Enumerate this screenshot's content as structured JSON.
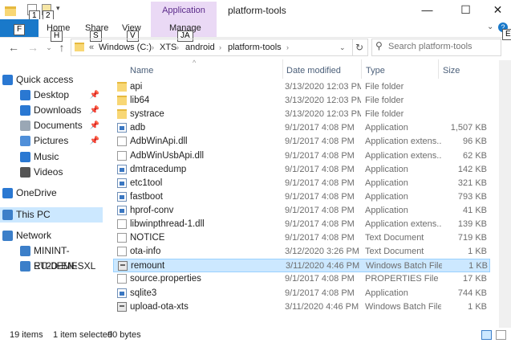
{
  "window": {
    "title": "platform-tools",
    "context_tab": "Application Tools",
    "minimize": "—",
    "maximize": "☐",
    "close": "✕"
  },
  "keytips": {
    "qa1": "1",
    "qa2": "2",
    "file": "F",
    "home": "H",
    "share": "S",
    "view": "V",
    "manage": "JA",
    "expand": "E"
  },
  "ribbon": {
    "file": "F",
    "tabs": [
      "Home",
      "Share",
      "View",
      "Manage"
    ]
  },
  "address": {
    "chevron": "«",
    "segments": [
      "Windows (C:)",
      "XTS",
      "android",
      "platform-tools"
    ],
    "search_placeholder": "Search platform-tools"
  },
  "columns": {
    "name": "Name",
    "date": "Date modified",
    "type": "Type",
    "size": "Size"
  },
  "sidebar": [
    {
      "label": "Quick access",
      "icon": "star-icon",
      "color": "#2a78d2"
    },
    {
      "label": "Desktop",
      "icon": "desktop-icon",
      "color": "#2a78d2",
      "pinned": true
    },
    {
      "label": "Downloads",
      "icon": "download-icon",
      "color": "#2a78d2",
      "pinned": true
    },
    {
      "label": "Documents",
      "icon": "documents-icon",
      "color": "#9aa7b5",
      "pinned": true
    },
    {
      "label": "Pictures",
      "icon": "pictures-icon",
      "color": "#4f8fd9",
      "pinned": true
    },
    {
      "label": "Music",
      "icon": "music-icon",
      "color": "#2a78d2"
    },
    {
      "label": "Videos",
      "icon": "videos-icon",
      "color": "#555"
    },
    {
      "label": "OneDrive",
      "icon": "cloud-icon",
      "color": "#2a78d2"
    },
    {
      "label": "This PC",
      "icon": "computer-icon",
      "color": "#3c7fc9"
    },
    {
      "label": "Network",
      "icon": "network-icon",
      "color": "#3c7fc9"
    },
    {
      "label": "MININT-ET20EME",
      "icon": "computer-icon",
      "color": "#3c7fc9"
    },
    {
      "label": "RU-D-EN-SXL",
      "icon": "computer-icon",
      "color": "#3c7fc9"
    }
  ],
  "files": [
    {
      "name": "api",
      "date": "3/13/2020 12:03 PM",
      "type": "File folder",
      "size": "",
      "icon": "folder"
    },
    {
      "name": "lib64",
      "date": "3/13/2020 12:03 PM",
      "type": "File folder",
      "size": "",
      "icon": "folder"
    },
    {
      "name": "systrace",
      "date": "3/13/2020 12:03 PM",
      "type": "File folder",
      "size": "",
      "icon": "folder"
    },
    {
      "name": "adb",
      "date": "9/1/2017 4:08 PM",
      "type": "Application",
      "size": "1,507 KB",
      "icon": "app"
    },
    {
      "name": "AdbWinApi.dll",
      "date": "9/1/2017 4:08 PM",
      "type": "Application extens...",
      "size": "96 KB",
      "icon": "doc"
    },
    {
      "name": "AdbWinUsbApi.dll",
      "date": "9/1/2017 4:08 PM",
      "type": "Application extens...",
      "size": "62 KB",
      "icon": "doc"
    },
    {
      "name": "dmtracedump",
      "date": "9/1/2017 4:08 PM",
      "type": "Application",
      "size": "142 KB",
      "icon": "app"
    },
    {
      "name": "etc1tool",
      "date": "9/1/2017 4:08 PM",
      "type": "Application",
      "size": "321 KB",
      "icon": "app"
    },
    {
      "name": "fastboot",
      "date": "9/1/2017 4:08 PM",
      "type": "Application",
      "size": "793 KB",
      "icon": "app"
    },
    {
      "name": "hprof-conv",
      "date": "9/1/2017 4:08 PM",
      "type": "Application",
      "size": "41 KB",
      "icon": "app"
    },
    {
      "name": "libwinpthread-1.dll",
      "date": "9/1/2017 4:08 PM",
      "type": "Application extens...",
      "size": "139 KB",
      "icon": "doc"
    },
    {
      "name": "NOTICE",
      "date": "9/1/2017 4:08 PM",
      "type": "Text Document",
      "size": "719 KB",
      "icon": "doc"
    },
    {
      "name": "ota-info",
      "date": "3/12/2020 3:26 PM",
      "type": "Text Document",
      "size": "1 KB",
      "icon": "doc"
    },
    {
      "name": "remount",
      "date": "3/11/2020 4:46 PM",
      "type": "Windows Batch File",
      "size": "1 KB",
      "icon": "bat",
      "selected": true
    },
    {
      "name": "source.properties",
      "date": "9/1/2017 4:08 PM",
      "type": "PROPERTIES File",
      "size": "17 KB",
      "icon": "doc"
    },
    {
      "name": "sqlite3",
      "date": "9/1/2017 4:08 PM",
      "type": "Application",
      "size": "744 KB",
      "icon": "app"
    },
    {
      "name": "upload-ota-xts",
      "date": "3/11/2020 4:46 PM",
      "type": "Windows Batch File",
      "size": "1 KB",
      "icon": "bat"
    }
  ],
  "status": {
    "count": "19 items",
    "selected": "1 item selected",
    "size": "90 bytes"
  },
  "colors": {
    "selection": "#cce8ff",
    "accent": "#1979ca",
    "context_tab": "#ead9f5"
  }
}
